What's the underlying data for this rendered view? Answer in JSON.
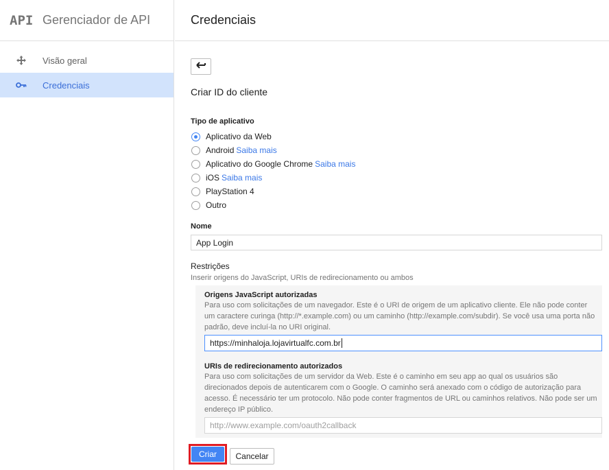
{
  "sidebar": {
    "logo": "API",
    "title": "Gerenciador de API",
    "items": [
      {
        "label": "Visão geral",
        "icon": "move-arrows-icon",
        "active": false
      },
      {
        "label": "Credenciais",
        "icon": "key-icon",
        "active": true
      }
    ]
  },
  "header": {
    "title": "Credenciais"
  },
  "form": {
    "subtitle": "Criar ID do cliente",
    "app_type_label": "Tipo de aplicativo",
    "app_types": [
      {
        "label": "Aplicativo da Web",
        "link": "",
        "selected": true
      },
      {
        "label": "Android",
        "link": "Saiba mais",
        "selected": false
      },
      {
        "label": "Aplicativo do Google Chrome",
        "link": "Saiba mais",
        "selected": false
      },
      {
        "label": "iOS",
        "link": "Saiba mais",
        "selected": false
      },
      {
        "label": "PlayStation 4",
        "link": "",
        "selected": false
      },
      {
        "label": "Outro",
        "link": "",
        "selected": false
      }
    ],
    "name_label": "Nome",
    "name_value": "App Login",
    "restrictions_title": "Restrições",
    "restrictions_desc": "Inserir origens do JavaScript, URIs de redirecionamento ou ambos",
    "js_origins_label": "Origens JavaScript autorizadas",
    "js_origins_desc": "Para uso com solicitações de um navegador. Este é o URI de origem de um aplicativo cliente. Ele não pode conter um caractere curinga (http://*.example.com) ou um caminho (http://example.com/subdir). Se você usa uma porta não padrão, deve incluí-la no URI original.",
    "js_origins_value": "https://minhaloja.lojavirtualfc.com.br",
    "redirect_label": "URIs de redirecionamento autorizados",
    "redirect_desc": "Para uso com solicitações de um servidor da Web. Este é o caminho em seu app ao qual os usuários são direcionados depois de autenticarem com o Google. O caminho será anexado com o código de autorização para acesso. É necessário ter um protocolo. Não pode conter fragmentos de URL ou caminhos relativos. Não pode ser um endereço IP público.",
    "redirect_placeholder": "http://www.example.com/oauth2callback",
    "create_label": "Criar",
    "cancel_label": "Cancelar"
  },
  "colors": {
    "accent": "#4285f4",
    "highlight_border": "#e01c24",
    "active_nav_bg": "#d2e3fc",
    "link": "#3b78e7"
  }
}
